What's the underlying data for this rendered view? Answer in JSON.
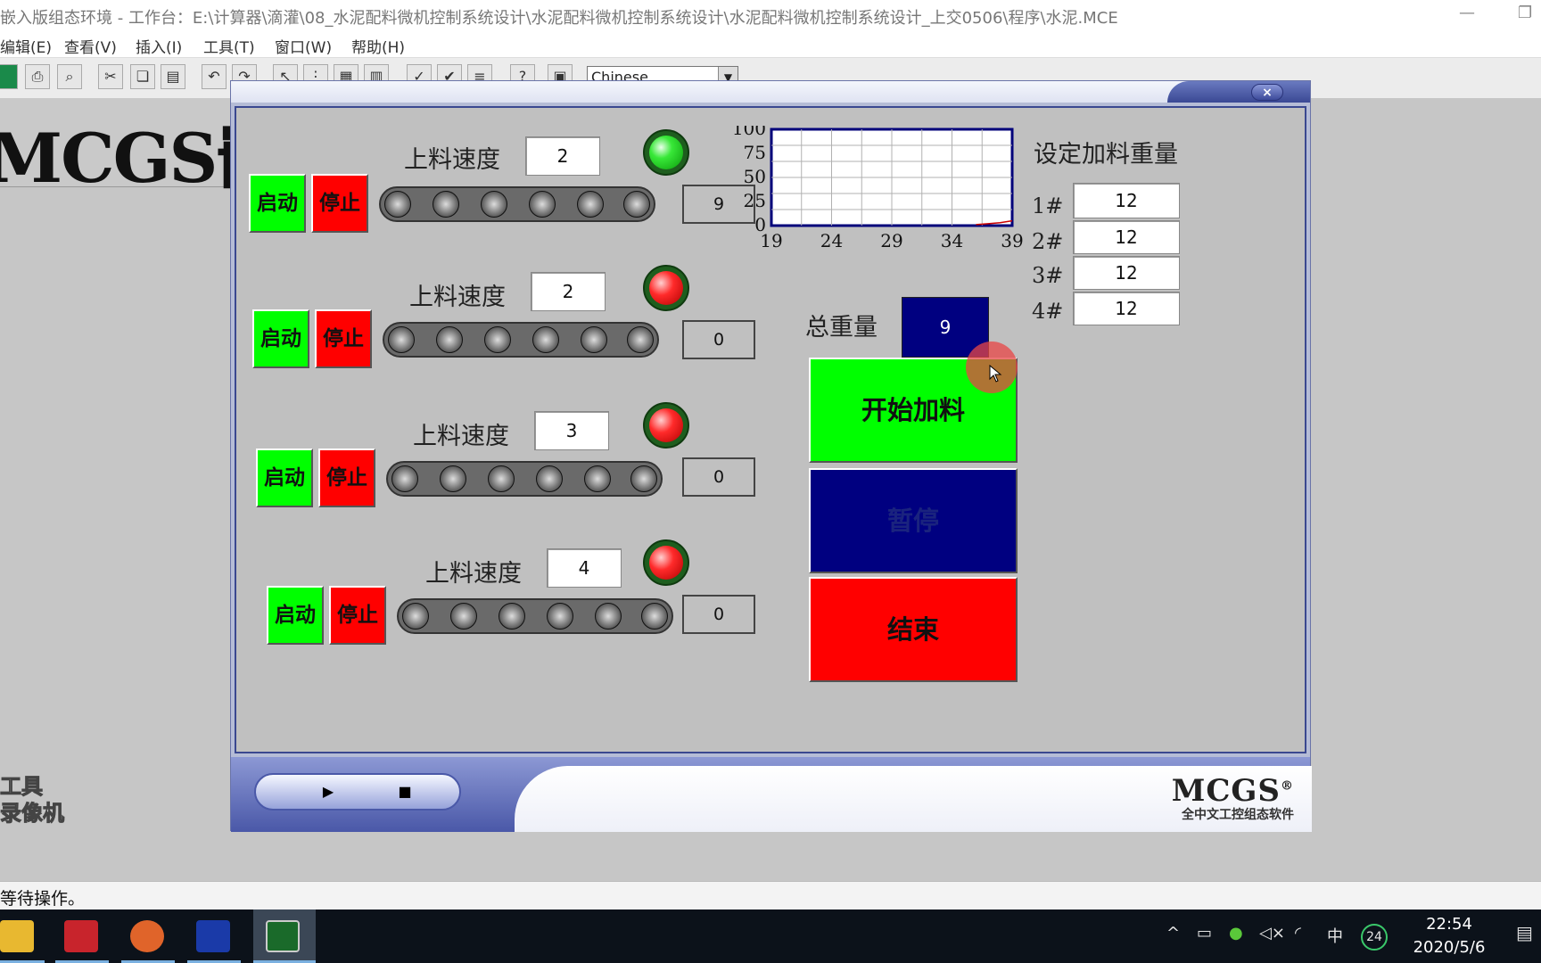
{
  "ide": {
    "title": "嵌入版组态环境 - 工作台：E:\\计算器\\滴灌\\08_水泥配料微机控制系统设计\\水泥配料微机控制系统设计\\水泥配料微机控制系统设计_上交0506\\程序\\水泥.MCE",
    "menus": [
      "编辑(E)",
      "查看(V)",
      "插入(I)",
      "工具(T)",
      "窗口(W)",
      "帮助(H)"
    ],
    "toolbar_combo": "Chinese",
    "banner": "MCGS嵌",
    "side_text_1": "工具",
    "side_text_2": "录像机",
    "status": "等待操作。"
  },
  "runtime": {
    "close_label": "×",
    "play_label": "▶",
    "stop_label": "■",
    "brand_name": "MCGS",
    "brand_mark": "®",
    "brand_sub": "全中文工控组态软件",
    "lines": [
      {
        "speed_label": "上料速度",
        "speed": "2",
        "lamp": "green",
        "start": "启动",
        "stop": "停止",
        "count": "9"
      },
      {
        "speed_label": "上料速度",
        "speed": "2",
        "lamp": "red",
        "start": "启动",
        "stop": "停止",
        "count": "0"
      },
      {
        "speed_label": "上料速度",
        "speed": "3",
        "lamp": "red",
        "start": "启动",
        "stop": "停止",
        "count": "0"
      },
      {
        "speed_label": "上料速度",
        "speed": "4",
        "lamp": "red",
        "start": "启动",
        "stop": "停止",
        "count": "0"
      }
    ],
    "total_label": "总重量",
    "total_value": "9",
    "set_title": "设定加料重量",
    "set_weights": [
      {
        "label": "1#",
        "value": "12"
      },
      {
        "label": "2#",
        "value": "12"
      },
      {
        "label": "3#",
        "value": "12"
      },
      {
        "label": "4#",
        "value": "12"
      }
    ],
    "btn_start": "开始加料",
    "btn_pause": "暂停",
    "btn_end": "结束",
    "colors": {
      "start_bg": "#00ff00",
      "pause_bg": "#000080",
      "end_bg": "#ff0000",
      "pause_text": "#1a237e"
    }
  },
  "chart_data": {
    "type": "line",
    "x_ticks": [
      "19",
      "24",
      "29",
      "34",
      "39"
    ],
    "y_ticks": [
      "100",
      "75",
      "50",
      "25",
      "0"
    ],
    "xlim": [
      19,
      39
    ],
    "ylim": [
      0,
      100
    ],
    "grid": true,
    "series": [
      {
        "color": "#cc0000",
        "x": [
          36,
          37,
          38,
          39
        ],
        "y": [
          1,
          2,
          3,
          5
        ]
      }
    ]
  },
  "taskbar": {
    "apps": [
      "file-explorer",
      "solidworks-2017",
      "screen-recorder",
      "mcgs",
      "mcgs-runtime"
    ],
    "tray_ime": "中",
    "tray_badge": "24",
    "time": "22:54",
    "date": "2020/5/6"
  }
}
